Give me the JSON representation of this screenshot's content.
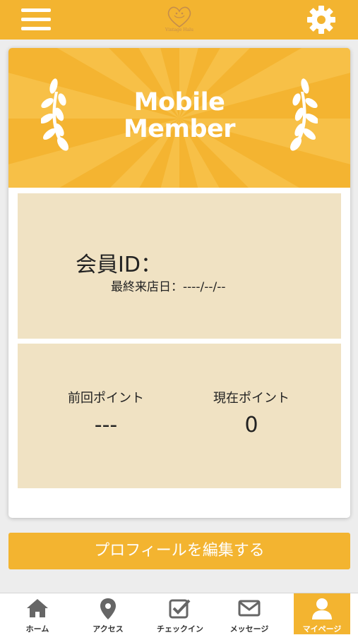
{
  "header": {
    "logo_text": "Vintage Halu",
    "menu_icon": "hamburger-menu-icon",
    "settings_icon": "gear-icon"
  },
  "banner": {
    "title_line1": "Mobile",
    "title_line2": "Member"
  },
  "member": {
    "id_label": "会員ID：",
    "last_visit": "最終来店日：----/--/--"
  },
  "points": {
    "previous_label": "前回ポイント",
    "previous_value": "---",
    "current_label": "現在ポイント",
    "current_value": "0"
  },
  "edit_profile_label": "プロフィールを編集する",
  "nav": [
    {
      "label": "ホーム",
      "icon": "home-icon"
    },
    {
      "label": "アクセス",
      "icon": "map-pin-icon"
    },
    {
      "label": "チェックイン",
      "icon": "checkbox-icon"
    },
    {
      "label": "メッセージ",
      "icon": "envelope-icon"
    },
    {
      "label": "マイページ",
      "icon": "user-icon",
      "active": true
    }
  ],
  "colors": {
    "accent": "#f3b430",
    "panel": "#f0e2c3",
    "background": "#ededed"
  }
}
